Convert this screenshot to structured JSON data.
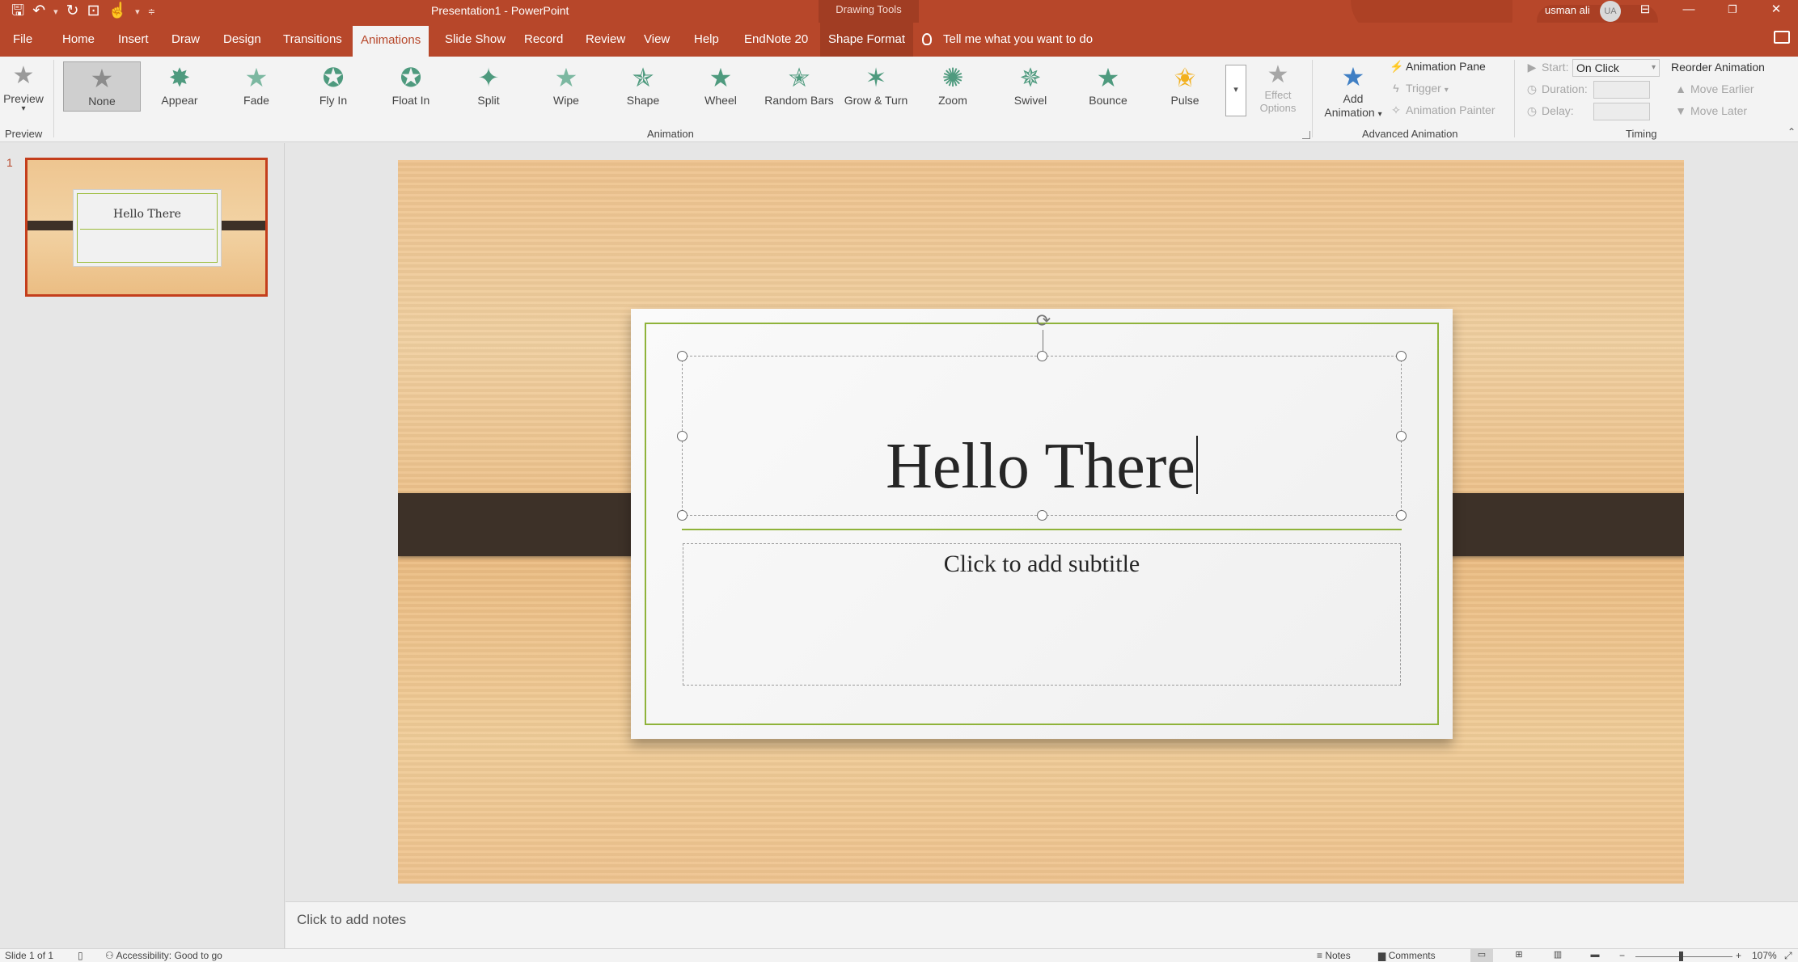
{
  "titlebar": {
    "title": "Presentation1  -  PowerPoint",
    "context_label": "Drawing Tools",
    "user_name": "usman ali",
    "user_initials": "UA"
  },
  "tabs": [
    {
      "label": "File"
    },
    {
      "label": "Home"
    },
    {
      "label": "Insert"
    },
    {
      "label": "Draw"
    },
    {
      "label": "Design"
    },
    {
      "label": "Transitions"
    },
    {
      "label": "Animations",
      "active": true
    },
    {
      "label": "Slide Show"
    },
    {
      "label": "Record"
    },
    {
      "label": "Review"
    },
    {
      "label": "View"
    },
    {
      "label": "Help"
    },
    {
      "label": "EndNote 20"
    },
    {
      "label": "Shape Format"
    }
  ],
  "tell_me": "Tell me what you want to do",
  "ribbon": {
    "preview": {
      "label": "Preview",
      "group": "Preview"
    },
    "animation_group": "Animation",
    "animations": [
      {
        "label": "None",
        "selected": true
      },
      {
        "label": "Appear"
      },
      {
        "label": "Fade"
      },
      {
        "label": "Fly In"
      },
      {
        "label": "Float In"
      },
      {
        "label": "Split"
      },
      {
        "label": "Wipe"
      },
      {
        "label": "Shape"
      },
      {
        "label": "Wheel"
      },
      {
        "label": "Random Bars"
      },
      {
        "label": "Grow & Turn"
      },
      {
        "label": "Zoom"
      },
      {
        "label": "Swivel"
      },
      {
        "label": "Bounce"
      },
      {
        "label": "Pulse"
      }
    ],
    "effect_options": {
      "line1": "Effect",
      "line2": "Options"
    },
    "advanced": {
      "group": "Advanced Animation",
      "add_animation_1": "Add",
      "add_animation_2": "Animation",
      "animation_pane": "Animation Pane",
      "trigger": "Trigger",
      "animation_painter": "Animation Painter"
    },
    "timing": {
      "group": "Timing",
      "start_label": "Start:",
      "start_value": "On Click",
      "duration_label": "Duration:",
      "delay_label": "Delay:",
      "reorder": "Reorder Animation",
      "move_earlier": "Move Earlier",
      "move_later": "Move Later"
    }
  },
  "thumbnails": [
    {
      "number": "1",
      "title": "Hello There"
    }
  ],
  "slide": {
    "title": "Hello There",
    "subtitle_placeholder": "Click to add subtitle"
  },
  "notes_placeholder": "Click to add notes",
  "status": {
    "slide_info": "Slide 1 of 1",
    "accessibility": "Accessibility: Good to go",
    "notes": "Notes",
    "comments": "Comments",
    "zoom_minus": "−",
    "zoom_plus": "+",
    "zoom_level": "107%"
  },
  "colors": {
    "accent": "#b7472a",
    "animation_star": "#4e9a7e",
    "card_border": "#8fb33a",
    "band": "#3d3128"
  }
}
